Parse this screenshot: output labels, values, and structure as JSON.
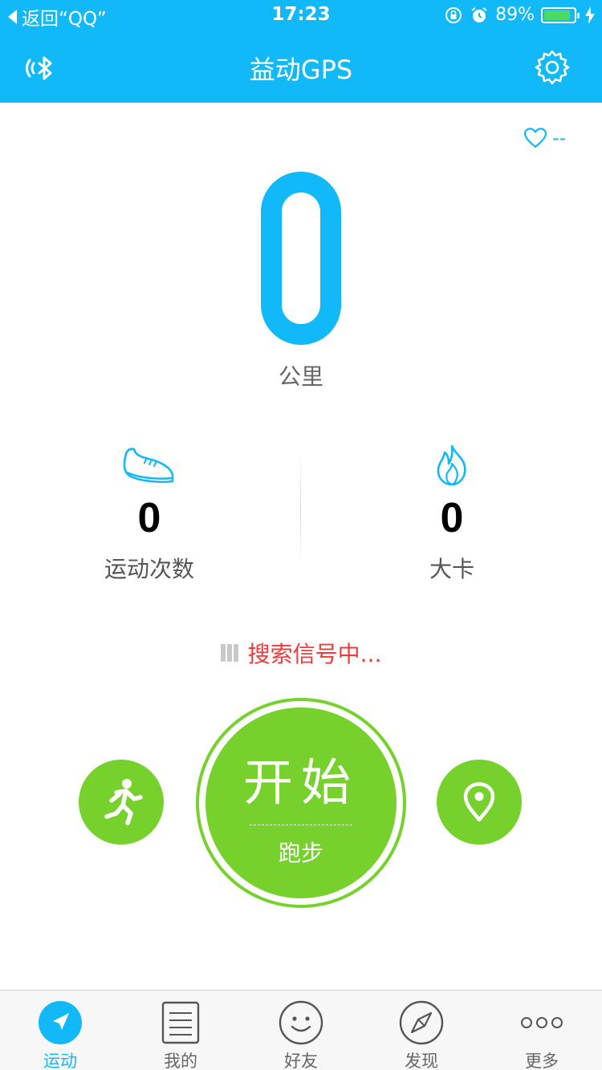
{
  "status_bar": {
    "back_label": "返回“QQ”",
    "time": "17:23",
    "battery": "89%",
    "battery_level": 0.89
  },
  "header": {
    "title": "益动GPS",
    "left_icon": "bluetooth-icon",
    "right_icon": "gear-icon"
  },
  "heart_rate": {
    "value": "--",
    "icon": "heart-icon"
  },
  "distance": {
    "value": "0",
    "unit": "公里"
  },
  "stats": {
    "workouts": {
      "value": "0",
      "label": "运动次数",
      "icon": "shoe-icon"
    },
    "calories": {
      "value": "0",
      "label": "大卡",
      "icon": "flame-icon"
    }
  },
  "gps_status": "搜索信号中...",
  "start_button": {
    "main": "开始",
    "sub": "跑步"
  },
  "side_buttons": {
    "left_icon": "running-person-icon",
    "right_icon": "location-pin-icon"
  },
  "tabbar": {
    "tabs": [
      {
        "label": "运动",
        "icon": "navigation-arrow-icon",
        "active": true
      },
      {
        "label": "我的",
        "icon": "document-icon",
        "active": false
      },
      {
        "label": "好友",
        "icon": "smiley-icon",
        "active": false
      },
      {
        "label": "发现",
        "icon": "compass-icon",
        "active": false
      },
      {
        "label": "更多",
        "icon": "more-dots-icon",
        "active": false
      }
    ]
  },
  "colors": {
    "primary": "#11b9f8",
    "green": "#76d12d",
    "alert": "#f03a3a"
  }
}
